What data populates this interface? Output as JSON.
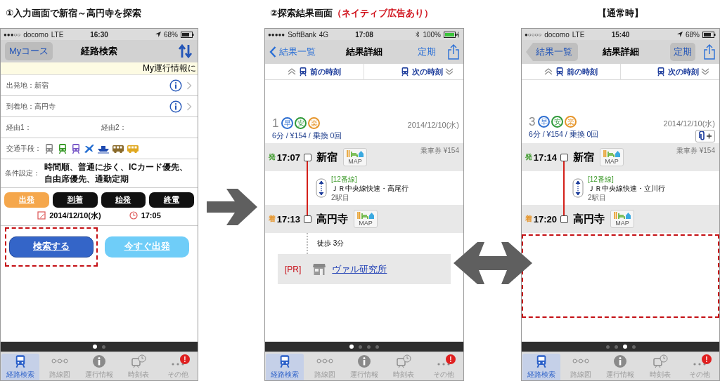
{
  "panels": [
    {
      "kind": "search",
      "heading": {
        "text": "①入力画面で新宿～高円寺を探索"
      },
      "status_bar": {
        "signal": "●●●○○",
        "carrier": "docomo",
        "network": "LTE",
        "time": "16:30",
        "location": true,
        "bluetooth": false,
        "battery": "68%",
        "charging": false
      },
      "nav": {
        "left_button": "Myコース",
        "title": "経路検索"
      },
      "banner": "My運行情報に",
      "places": [
        {
          "text": "出発地：新宿"
        },
        {
          "text": "到着地：高円寺"
        }
      ],
      "via": [
        "経由1：",
        "経由2："
      ],
      "transport_label": "交通手段：",
      "conditions": {
        "label": "条件設定：",
        "value": "時間順、普通に歩く、ICカード優先、自由席優先、通勤定期"
      },
      "modes": [
        {
          "label": "出発",
          "selected": true
        },
        {
          "label": "到着",
          "selected": false
        },
        {
          "label": "始発",
          "selected": false
        },
        {
          "label": "終電",
          "selected": false
        }
      ],
      "date": "2014/12/10(水)",
      "time": "17:05",
      "actions": [
        {
          "label": "検索する",
          "kind": "primary",
          "highlighted": true
        },
        {
          "label": "今すぐ出発",
          "kind": "secondary",
          "highlighted": false
        }
      ],
      "page_dots": [
        {
          "selected": true
        },
        {
          "selected": false
        }
      ],
      "tabs": [
        {
          "label": "経路検索",
          "selected": true
        },
        {
          "label": "路線図",
          "selected": false
        },
        {
          "label": "運行情報",
          "selected": false
        },
        {
          "label": "時刻表",
          "selected": false
        },
        {
          "label": "その他",
          "selected": false,
          "badge": "!"
        }
      ]
    },
    {
      "kind": "result",
      "heading": {
        "text": "②探索結果画面",
        "note": "（ネイティブ広告あり）"
      },
      "status_bar": {
        "signal": "●●●●●",
        "carrier": "SoftBank",
        "network": "4G",
        "time": "17:08",
        "location": false,
        "bluetooth": true,
        "battery": "100%",
        "charging": true
      },
      "nav": {
        "kind": "flat",
        "back": "結果一覧",
        "title": "結果詳細",
        "right_button": "定期"
      },
      "time_nav": {
        "prev": "前の時刻",
        "next": "次の時刻"
      },
      "route": {
        "number": "1",
        "badges": [
          {
            "text": "早",
            "color": "#2f6fd0"
          },
          {
            "text": "安",
            "color": "#2f9a3a"
          },
          {
            "text": "楽",
            "color": "#e6952a"
          }
        ],
        "date": "2014/12/10(水)",
        "summary": "6分 / ¥154 / 乗換 0回",
        "clip_button": false
      },
      "fare": "乗車券 ¥154",
      "stops": [
        {
          "kind": "departure",
          "mark": "発",
          "time": "17:07",
          "name": "新宿",
          "map": "MAP"
        },
        {
          "kind": "arrival",
          "mark": "着",
          "time": "17:13",
          "name": "高円寺",
          "map": "MAP"
        }
      ],
      "segment": {
        "platform": "[12番線]",
        "line": "ＪＲ中央線快速・高尾行",
        "stops": "2駅目"
      },
      "walk": "徒歩 3分",
      "ad": {
        "tag": "[PR]",
        "name": "ヴァル研究所"
      },
      "ad_slot_highlighted": false,
      "page_dots": [
        {
          "selected": true
        },
        {
          "selected": false
        },
        {
          "selected": false
        },
        {
          "selected": false
        }
      ],
      "tabs": [
        {
          "label": "経路検索",
          "selected": true
        },
        {
          "label": "路線図",
          "selected": false
        },
        {
          "label": "運行情報",
          "selected": false
        },
        {
          "label": "時刻表",
          "selected": false
        },
        {
          "label": "その他",
          "selected": false,
          "badge": "!"
        }
      ]
    },
    {
      "kind": "result",
      "heading": {
        "text": "【通常時】"
      },
      "status_bar": {
        "signal": "●○○○○",
        "carrier": "docomo",
        "network": "LTE",
        "time": "15:40",
        "location": true,
        "bluetooth": false,
        "battery": "68%",
        "charging": false
      },
      "nav": {
        "kind": "boxed",
        "back": "結果一覧",
        "title": "結果詳細",
        "right_button": "定期"
      },
      "time_nav": {
        "prev": "前の時刻",
        "next": "次の時刻"
      },
      "route": {
        "number": "3",
        "badges": [
          {
            "text": "早",
            "color": "#2f6fd0"
          },
          {
            "text": "安",
            "color": "#2f9a3a"
          },
          {
            "text": "楽",
            "color": "#e6952a"
          }
        ],
        "date": "2014/12/10(水)",
        "summary": "6分 / ¥154 / 乗換 0回",
        "clip_button": true
      },
      "fare": "乗車券 ¥154",
      "stops": [
        {
          "kind": "departure",
          "mark": "発",
          "time": "17:14",
          "name": "新宿",
          "map": "MAP"
        },
        {
          "kind": "arrival",
          "mark": "着",
          "time": "17:20",
          "name": "高円寺",
          "map": "MAP"
        }
      ],
      "segment": {
        "platform": "[12番線]",
        "line": "ＪＲ中央線快速・立川行",
        "stops": "2駅目"
      },
      "ad_slot_highlighted": true,
      "page_dots": [
        {
          "selected": false
        },
        {
          "selected": false
        },
        {
          "selected": true
        },
        {
          "selected": false
        }
      ],
      "tabs": [
        {
          "label": "経路検索",
          "selected": true
        },
        {
          "label": "路線図",
          "selected": false
        },
        {
          "label": "運行情報",
          "selected": false
        },
        {
          "label": "時刻表",
          "selected": false
        },
        {
          "label": "その他",
          "selected": false,
          "badge": "!"
        }
      ]
    }
  ]
}
